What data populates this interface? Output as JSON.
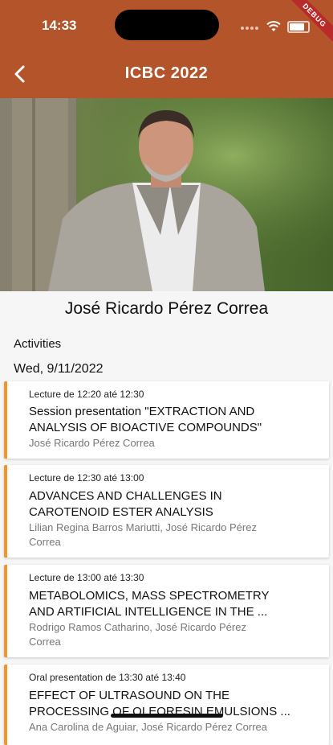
{
  "status": {
    "time": "14:33",
    "debug": "DEBUG"
  },
  "header": {
    "title": "ICBC 2022"
  },
  "speaker": {
    "name": "José Ricardo Pérez Correa"
  },
  "activities_label": "Activities",
  "date": "Wed, 9/11/2022",
  "activities": [
    {
      "meta": "Lecture de 12:20 até 12:30",
      "title_line1": "Session presentation \"EXTRACTION AND",
      "title_line2": "ANALYSIS OF BIOACTIVE COMPOUNDS\"",
      "authors_line1": "José Ricardo Pérez Correa",
      "authors_line2": ""
    },
    {
      "meta": "Lecture de 12:30 até 13:00",
      "title_line1": "ADVANCES AND CHALLENGES IN",
      "title_line2": "CAROTENOID ESTER ANALYSIS",
      "authors_line1": "Lilian Regina Barros Mariutti, José Ricardo Pérez",
      "authors_line2": "Correa"
    },
    {
      "meta": "Lecture de 13:00 até 13:30",
      "title_line1": "METABOLOMICS, MASS SPECTROMETRY",
      "title_line2": "AND ARTIFICIAL INTELLIGENCE IN THE ...",
      "authors_line1": "Rodrigo Ramos Catharino, José Ricardo Pérez",
      "authors_line2": "Correa"
    },
    {
      "meta": "Oral presentation de 13:30 até 13:40",
      "title_line1": "EFFECT OF ULTRASOUND ON THE",
      "title_line2": "PROCESSING OF OLEORESIN EMULSIONS ...",
      "authors_line1": "Ana Carolina de Aguiar, José Ricardo Pérez Correa",
      "authors_line2": ""
    }
  ],
  "colors": {
    "appbar": "#b4542a",
    "accent": "#f0962a"
  },
  "icons": {
    "back": "chevron-left-icon",
    "wifi": "wifi-icon",
    "battery": "battery-icon"
  }
}
